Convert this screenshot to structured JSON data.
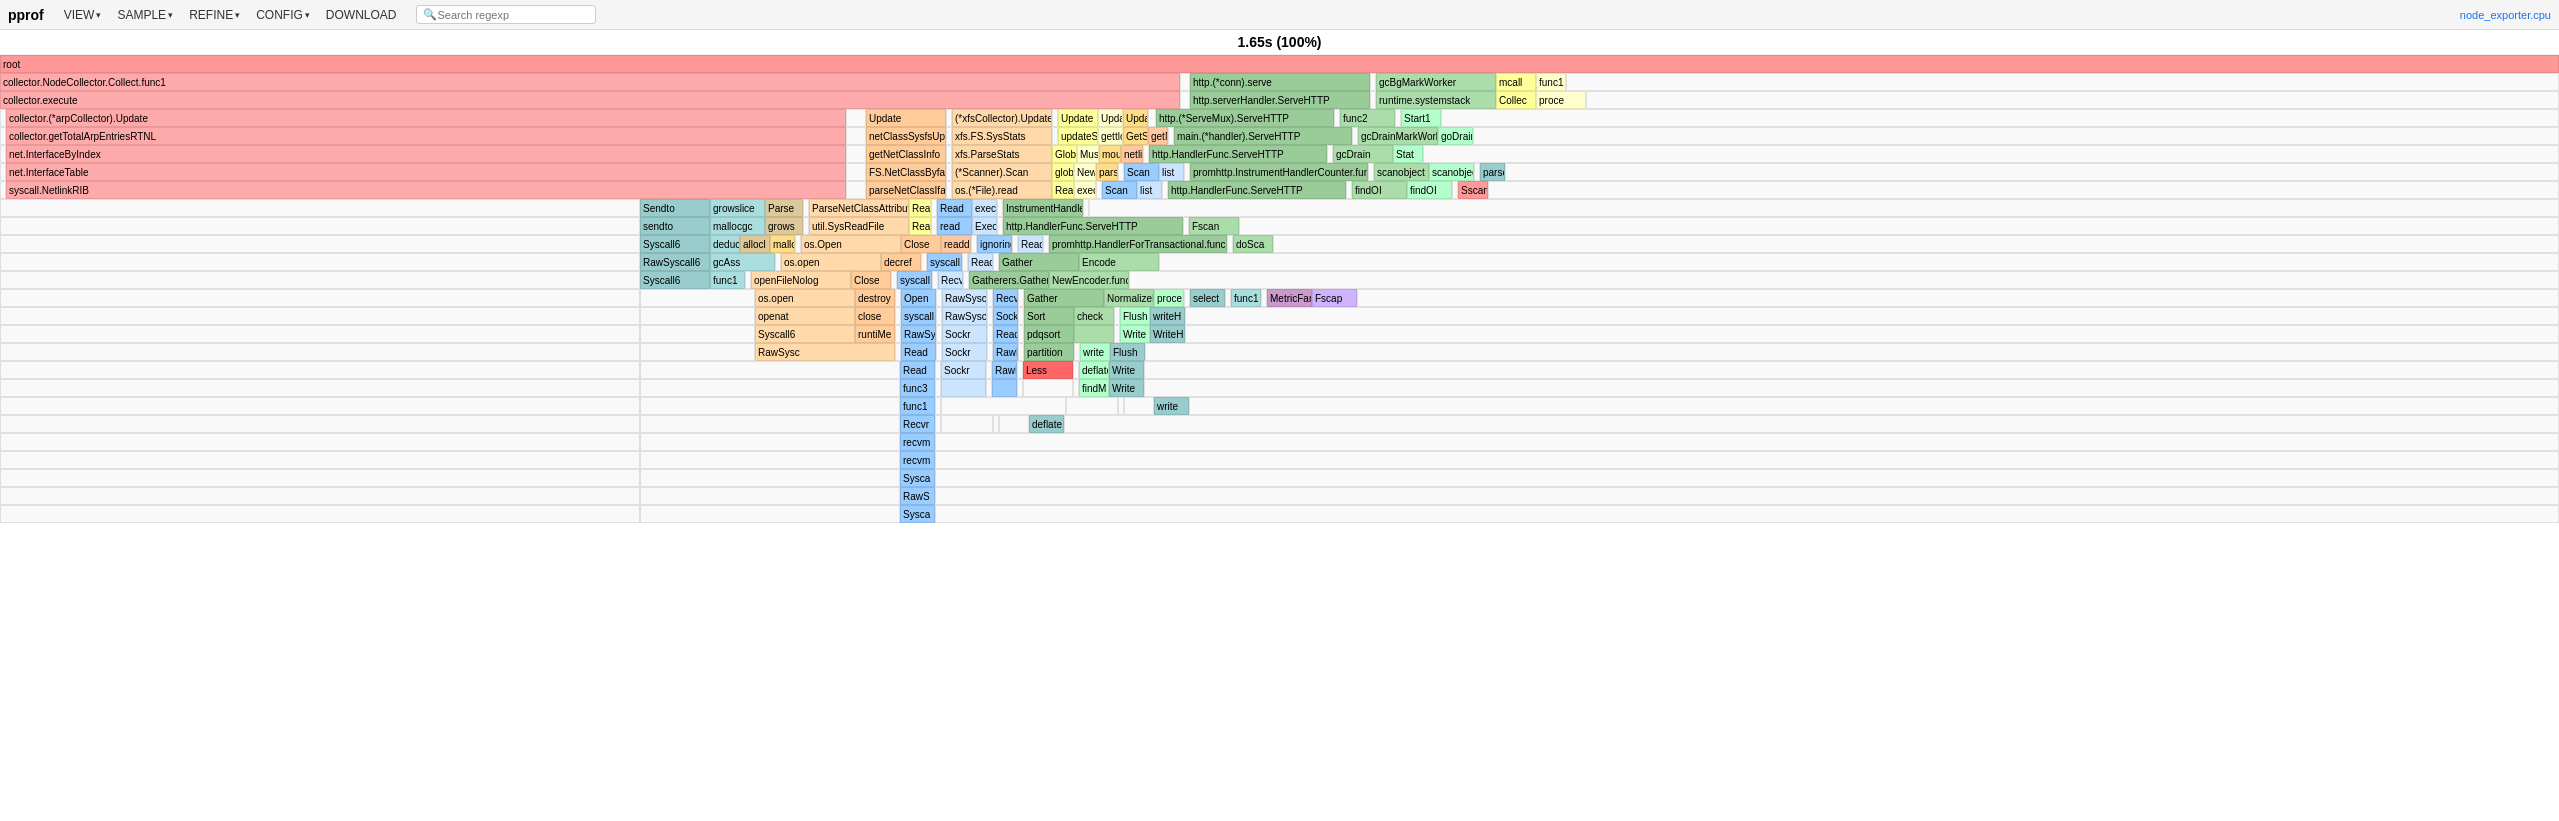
{
  "app": {
    "title": "pprof",
    "title_display": "1.65s (100%)",
    "external_link": "node_exporter.cpu"
  },
  "topbar": {
    "logo": "pprof",
    "menus": [
      "VIEW",
      "SAMPLE",
      "REFINE",
      "CONFIG",
      "DOWNLOAD"
    ],
    "search_placeholder": "Search regexp"
  }
}
